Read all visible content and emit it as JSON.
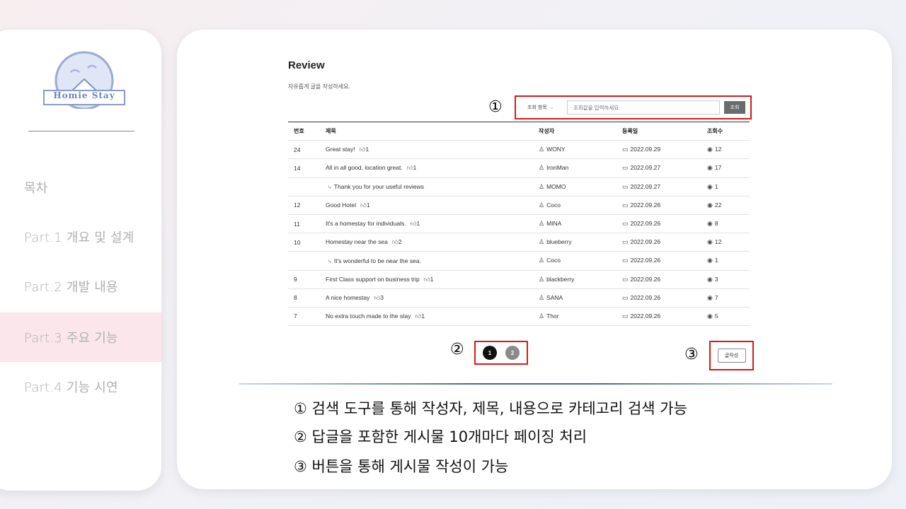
{
  "sidebar": {
    "logo_text": "Homie Stay",
    "items": [
      {
        "label": "목차"
      },
      {
        "label": "Part.1 개요 및 설계"
      },
      {
        "label": "Part.2 개발 내용"
      },
      {
        "label": "Part.3 주요 기능"
      },
      {
        "label": "Part.4 기능 시연"
      }
    ],
    "active_index": 3
  },
  "review": {
    "title": "Review",
    "subtitle": "자유롭게 글을 작성하세요.",
    "search": {
      "select_label": "조회 항목",
      "input_placeholder": "조회값을 입력하세요.",
      "button_label": "조회"
    },
    "columns": [
      "번호",
      "제목",
      "작성자",
      "등록일",
      "조회수"
    ],
    "rows": [
      {
        "no": "24",
        "title": "Great stay!",
        "likes": "1",
        "author": "WONY",
        "date": "2022.09.29",
        "views": "12"
      },
      {
        "no": "14",
        "title": "All in all good, location great.",
        "likes": "1",
        "author": "IronMan",
        "date": "2022.09.27",
        "views": "17"
      },
      {
        "no": "",
        "title": "Thank you for your useful reviews",
        "likes": "",
        "author": "MOMO",
        "date": "2022.09.27",
        "views": "1",
        "reply": true
      },
      {
        "no": "12",
        "title": "Good Hotel",
        "likes": "1",
        "author": "Coco",
        "date": "2022.09.26",
        "views": "22"
      },
      {
        "no": "11",
        "title": "It's a homestay for individuals.",
        "likes": "1",
        "author": "MINA",
        "date": "2022.09.26",
        "views": "8"
      },
      {
        "no": "10",
        "title": "Homestay near the sea",
        "likes": "2",
        "author": "blueberry",
        "date": "2022.09.26",
        "views": "12"
      },
      {
        "no": "",
        "title": "It's wonderful to be near the sea.",
        "likes": "",
        "author": "Coco",
        "date": "2022.09.26",
        "views": "1",
        "reply": true
      },
      {
        "no": "9",
        "title": "First Class support on business trip",
        "likes": "1",
        "author": "blackberry",
        "date": "2022.09.26",
        "views": "3"
      },
      {
        "no": "8",
        "title": "A nice homestay",
        "likes": "3",
        "author": "SANA",
        "date": "2022.09.26",
        "views": "7"
      },
      {
        "no": "7",
        "title": "No extra touch made to the stay",
        "likes": "1",
        "author": "Thor",
        "date": "2022.09.26",
        "views": "5"
      }
    ],
    "pages": [
      "1",
      "2"
    ],
    "current_page": "1",
    "write_label": "글작성"
  },
  "markers": [
    "①",
    "②",
    "③"
  ],
  "descriptions": [
    "① 검색 도구를 통해 작성자, 제목, 내용으로 카테고리 검색 가능",
    "② 답글을 포함한 게시물 10개마다 페이징 처리",
    "③ 버튼을 통해 게시물 작성이 가능"
  ],
  "colors": {
    "highlight": "#d41a1a",
    "active_nav": "#fbe6ec",
    "accent_line": "#3f6a9e"
  }
}
